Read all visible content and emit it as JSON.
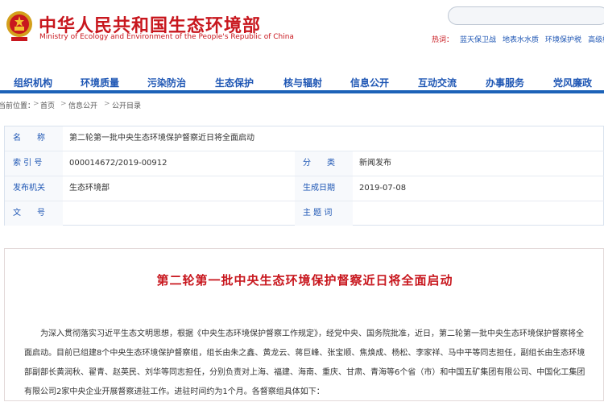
{
  "header": {
    "title_cn": "中华人民共和国生态环境部",
    "title_en": "Ministry of Ecology and Environment of the People's Republic of China",
    "hot_label": "热词：",
    "hot_links": [
      "蓝天保卫战",
      "地表水水质",
      "环境保护税",
      "高级检索"
    ]
  },
  "nav": {
    "items": [
      "组织机构",
      "环境质量",
      "污染防治",
      "生态保护",
      "核与辐射",
      "信息公开",
      "互动交流",
      "办事服务",
      "党风廉政"
    ]
  },
  "breadcrumb": {
    "prefix": "当前位置：",
    "items": [
      "首页",
      "信息公开",
      "公开目录"
    ]
  },
  "info": {
    "name_label": "名　　称",
    "name_value": "第二轮第一批中央生态环境保护督察近日将全面启动",
    "index_label": "索 引 号",
    "index_value": "000014672/2019-00912",
    "category_label": "分　　类",
    "category_value": "新闻发布",
    "issuer_label": "发布机关",
    "issuer_value": "生态环境部",
    "date_label": "生成日期",
    "date_value": "2019-07-08",
    "docno_label": "文　　号",
    "docno_value": "",
    "subject_label": "主 题 词",
    "subject_value": ""
  },
  "article": {
    "title": "第二轮第一批中央生态环境保护督察近日将全面启动",
    "body": "为深入贯彻落实习近平生态文明思想，根据《中央生态环境保护督察工作规定》，经党中央、国务院批准，近日，第二轮第一批中央生态环境保护督察将全面启动。目前已组建8个中央生态环境保护督察组，组长由朱之鑫、黄龙云、蒋巨峰、张宝顺、焦焕成、杨松、李家祥、马中平等同志担任，副组长由生态环境部副部长黄润秋、翟青、赵英民、刘华等同志担任，分别负责对上海、福建、海南、重庆、甘肃、青海等6个省（市）和中国五矿集团有限公司、中国化工集团有限公司2家中央企业开展督察进驻工作。进驻时间约为1个月。各督察组具体如下："
  },
  "colors": {
    "brand_red": "#c8171e",
    "nav_blue": "#1e56b4",
    "nav_bar": "#1c62b8"
  }
}
